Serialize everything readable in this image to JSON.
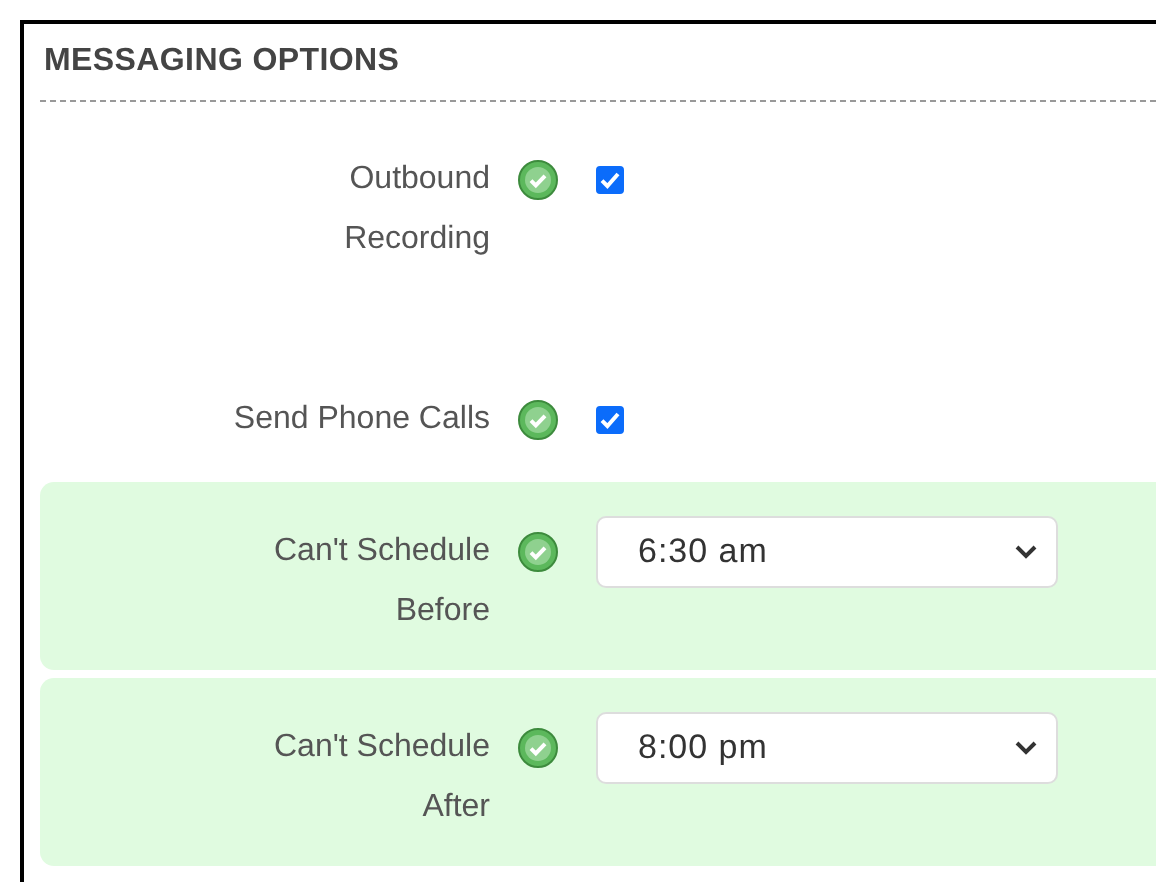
{
  "section": {
    "title": "MESSAGING OPTIONS"
  },
  "fields": [
    {
      "kind": "checkbox",
      "label": "Outbound\nRecording",
      "checked": true,
      "highlighted": false
    },
    {
      "kind": "checkbox",
      "label": "Send Phone Calls",
      "checked": true,
      "highlighted": false
    },
    {
      "kind": "select",
      "label": "Can't Schedule\nBefore",
      "value": "6:30 am",
      "highlighted": true
    },
    {
      "kind": "select",
      "label": "Can't Schedule\nAfter",
      "value": "8:00 pm",
      "highlighted": true
    }
  ]
}
